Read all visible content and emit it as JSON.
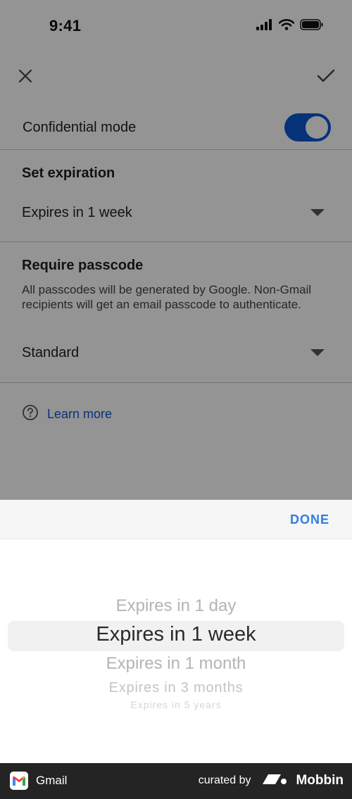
{
  "status_bar": {
    "time": "9:41"
  },
  "top_bar": {
    "close_icon": "close-icon",
    "confirm_icon": "check-icon"
  },
  "confidential": {
    "label": "Confidential mode",
    "enabled": true,
    "toggle_color": "#0b57d0"
  },
  "expiration": {
    "title": "Set expiration",
    "value": "Expires in 1 week"
  },
  "passcode": {
    "title": "Require passcode",
    "description": "All passcodes will be generated by Google. Non-Gmail recipients will get an email passcode to authenticate.",
    "value": "Standard"
  },
  "learn_more": {
    "label": "Learn more",
    "icon": "help-circle-icon"
  },
  "picker": {
    "done_label": "DONE",
    "options": [
      "Expires in 1 day",
      "Expires in 1 week",
      "Expires in 1 month",
      "Expires in 3 months",
      "Expires in 5 years"
    ],
    "selected": "Expires in 1 week"
  },
  "footer": {
    "app_name": "Gmail",
    "curated_by": "curated by",
    "brand": "Mobbin"
  },
  "colors": {
    "accent": "#0b57d0",
    "done": "#2f7de1",
    "footer_bg": "#242424"
  }
}
